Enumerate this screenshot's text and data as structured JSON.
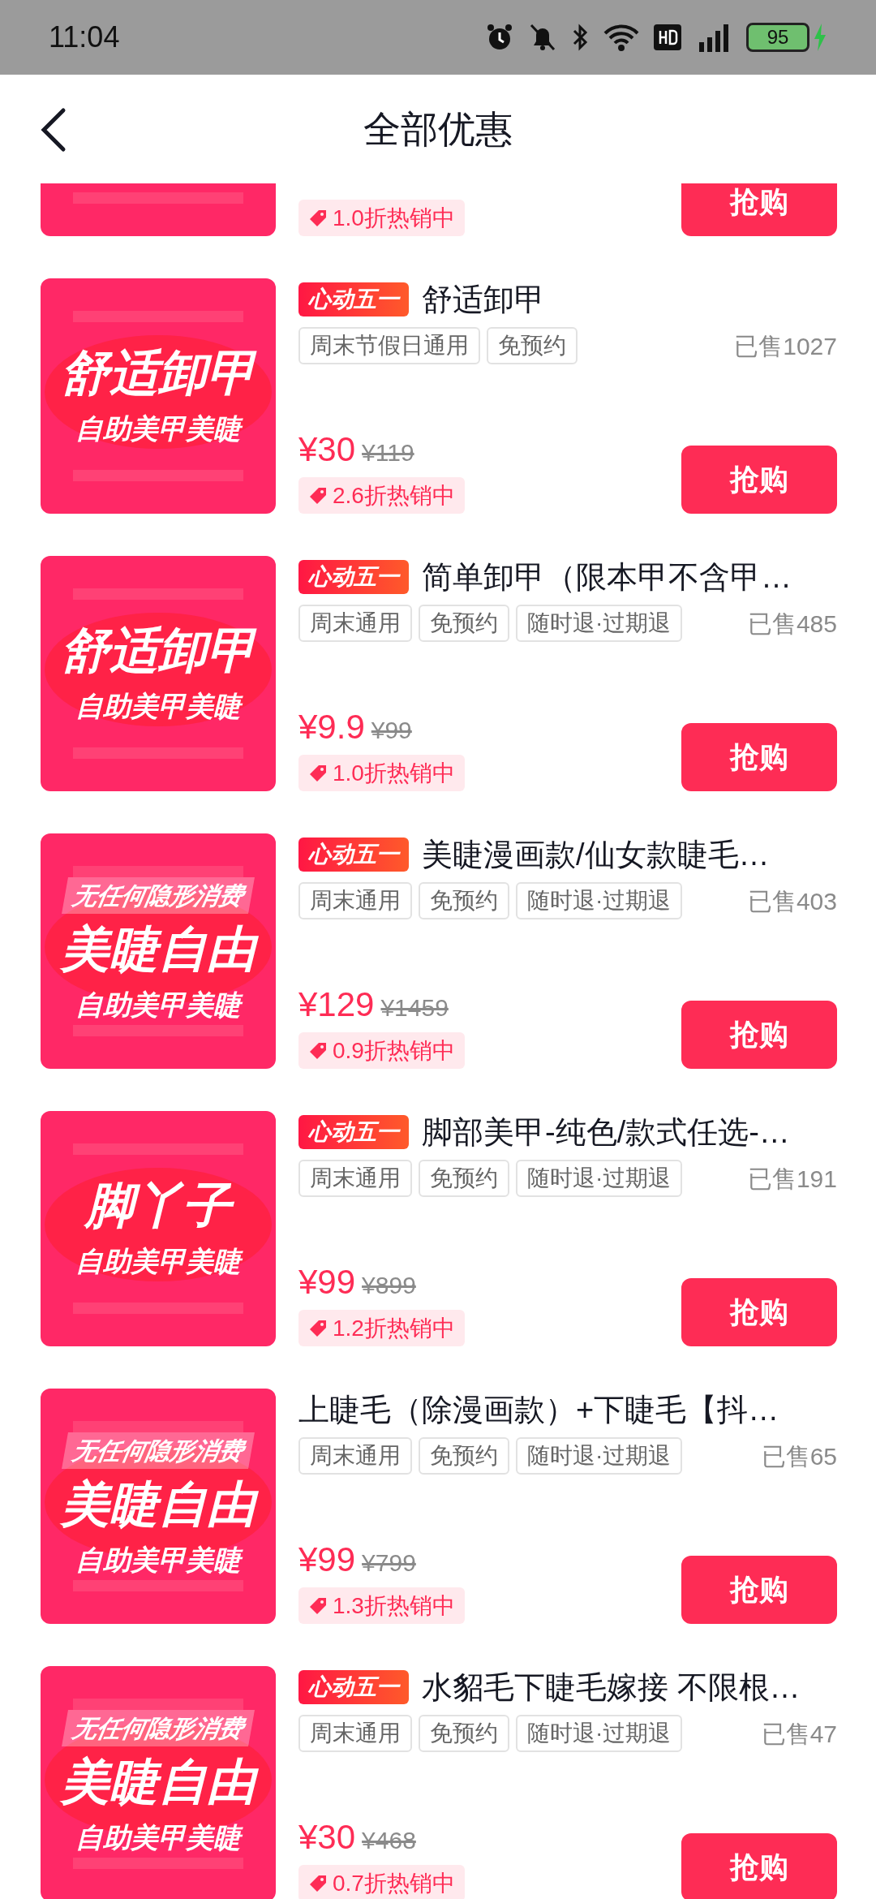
{
  "status_bar": {
    "time": "11:04",
    "battery": "95"
  },
  "header": {
    "title": "全部优惠"
  },
  "deals": [
    {
      "discount": "1.0折热销中",
      "button": "抢购"
    },
    {
      "promo": "心动五一",
      "title": "舒适卸甲",
      "tags": [
        "周末节假日通用",
        "免预约"
      ],
      "sold": "已售1027",
      "price": "¥30",
      "original_price": "¥119",
      "discount": "2.6折热销中",
      "button": "抢购",
      "thumb": {
        "headline": "舒适卸甲",
        "subline": "自助美甲美睫"
      }
    },
    {
      "promo": "心动五一",
      "title": "简单卸甲（限本甲不含甲…",
      "tags": [
        "周末通用",
        "免预约",
        "随时退·过期退"
      ],
      "sold": "已售485",
      "price": "¥9.9",
      "original_price": "¥99",
      "discount": "1.0折热销中",
      "button": "抢购",
      "thumb": {
        "headline": "舒适卸甲",
        "subline": "自助美甲美睫"
      }
    },
    {
      "promo": "心动五一",
      "title": "美睫漫画款/仙女款睫毛…",
      "tags": [
        "周末通用",
        "免预约",
        "随时退·过期退"
      ],
      "sold": "已售403",
      "price": "¥129",
      "original_price": "¥1459",
      "discount": "0.9折热销中",
      "button": "抢购",
      "thumb": {
        "ribbon": "无任何隐形消费",
        "headline": "美睫自由",
        "subline": "自助美甲美睫"
      }
    },
    {
      "promo": "心动五一",
      "title": "脚部美甲-纯色/款式任选-…",
      "tags": [
        "周末通用",
        "免预约",
        "随时退·过期退"
      ],
      "sold": "已售191",
      "price": "¥99",
      "original_price": "¥899",
      "discount": "1.2折热销中",
      "button": "抢购",
      "thumb": {
        "headline": "脚丫子",
        "subline": "自助美甲美睫"
      }
    },
    {
      "title": "上睫毛（除漫画款）+下睫毛【抖…",
      "tags": [
        "周末通用",
        "免预约",
        "随时退·过期退"
      ],
      "sold": "已售65",
      "price": "¥99",
      "original_price": "¥799",
      "discount": "1.3折热销中",
      "button": "抢购",
      "thumb": {
        "ribbon": "无任何隐形消费",
        "headline": "美睫自由",
        "subline": "自助美甲美睫"
      }
    },
    {
      "promo": "心动五一",
      "title": "水貂毛下睫毛嫁接 不限根…",
      "tags": [
        "周末通用",
        "免预约",
        "随时退·过期退"
      ],
      "sold": "已售47",
      "price": "¥30",
      "original_price": "¥468",
      "discount": "0.7折热销中",
      "button": "抢购",
      "thumb": {
        "ribbon": "无任何隐形消费",
        "headline": "美睫自由",
        "subline": "自助美甲美睫"
      }
    }
  ]
}
